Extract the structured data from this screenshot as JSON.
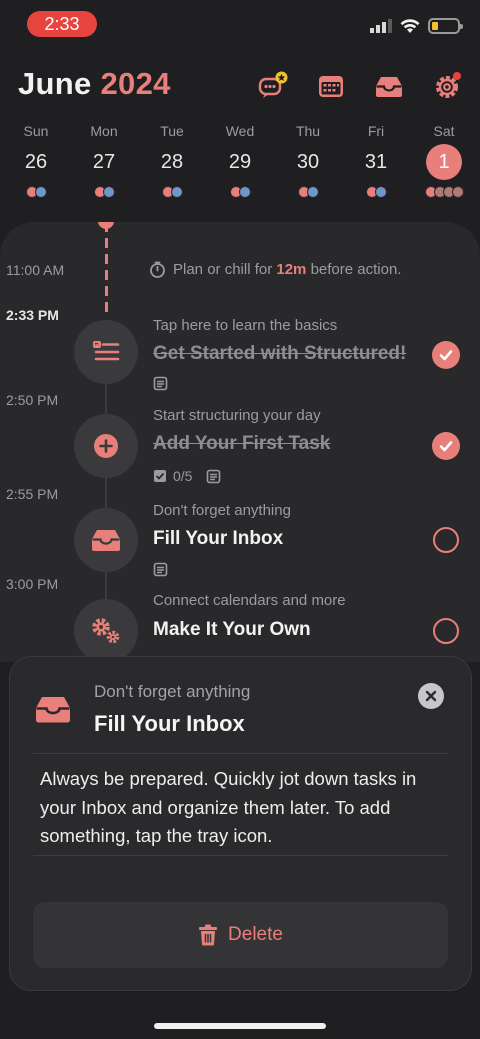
{
  "status_bar": {
    "time": "2:33"
  },
  "header": {
    "month": "June",
    "year": "2024"
  },
  "week": [
    {
      "name": "Sun",
      "num": "26",
      "dots": [
        "r",
        "b"
      ]
    },
    {
      "name": "Mon",
      "num": "27",
      "dots": [
        "r",
        "b"
      ]
    },
    {
      "name": "Tue",
      "num": "28",
      "dots": [
        "r",
        "b"
      ]
    },
    {
      "name": "Wed",
      "num": "29",
      "dots": [
        "r",
        "b"
      ]
    },
    {
      "name": "Thu",
      "num": "30",
      "dots": [
        "r",
        "b"
      ]
    },
    {
      "name": "Fri",
      "num": "31",
      "dots": [
        "r",
        "b"
      ]
    },
    {
      "name": "Sat",
      "num": "1",
      "dots": [
        "r",
        "g",
        "g",
        "g"
      ],
      "selected": true
    }
  ],
  "timeline": {
    "labels": {
      "t1": "11:00 AM",
      "now": "2:33 PM",
      "t2": "2:50 PM",
      "t3": "2:55 PM",
      "t4": "3:00 PM"
    },
    "plan": {
      "pre": "Plan or chill for ",
      "duration": "12m",
      "post": " before action."
    },
    "tasks": [
      {
        "sub": "Tap here to learn the basics",
        "title": "Get Started with Structured!",
        "done": true
      },
      {
        "sub": "Start structuring your day",
        "title": "Add Your First Task",
        "done": true,
        "subtasks": "0/5"
      },
      {
        "sub": "Don't forget anything",
        "title": "Fill Your Inbox",
        "done": false
      },
      {
        "sub": "Connect calendars and more",
        "title": "Make It Your Own",
        "done": false
      }
    ]
  },
  "sheet": {
    "subtitle": "Don't forget anything",
    "title": "Fill Your Inbox",
    "body": "Always be prepared. Quickly jot down tasks in your Inbox and organize them later. To add something, tap the tray icon.",
    "delete_label": "Delete"
  },
  "colors": {
    "accent": "#e87f7a",
    "background": "#1f1f21",
    "card": "#29292b"
  },
  "icons": [
    "chat-star-icon",
    "calendar-icon",
    "inbox-tray-icon",
    "gear-icon",
    "timer-icon",
    "list-icon",
    "plus-icon",
    "gears-icon",
    "checkmark-icon",
    "note-icon",
    "close-icon",
    "trash-icon"
  ]
}
